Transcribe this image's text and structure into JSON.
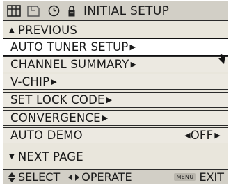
{
  "header": {
    "icons": [
      "grid-icon",
      "page-icon",
      "clock-icon",
      "lock-icon"
    ],
    "title": "INITIAL SETUP"
  },
  "nav": {
    "previous": "PREVIOUS",
    "next_page": "NEXT PAGE"
  },
  "menu": {
    "items": [
      {
        "label": "AUTO TUNER SETUP",
        "selected": true
      },
      {
        "label": "CHANNEL SUMMARY"
      },
      {
        "label": "V-CHIP"
      },
      {
        "label": "SET LOCK CODE"
      },
      {
        "label": "CONVERGENCE"
      },
      {
        "label": "AUTO DEMO",
        "value": "OFF"
      }
    ]
  },
  "footer": {
    "select_label": "SELECT",
    "operate_label": "OPERATE",
    "menu_key": "MENU",
    "exit_label": "EXIT"
  },
  "colors": {
    "panel": "#e9e6dc",
    "bar": "#d2cfc6",
    "selected": "#ffffff",
    "border": "#2a2a2a"
  }
}
